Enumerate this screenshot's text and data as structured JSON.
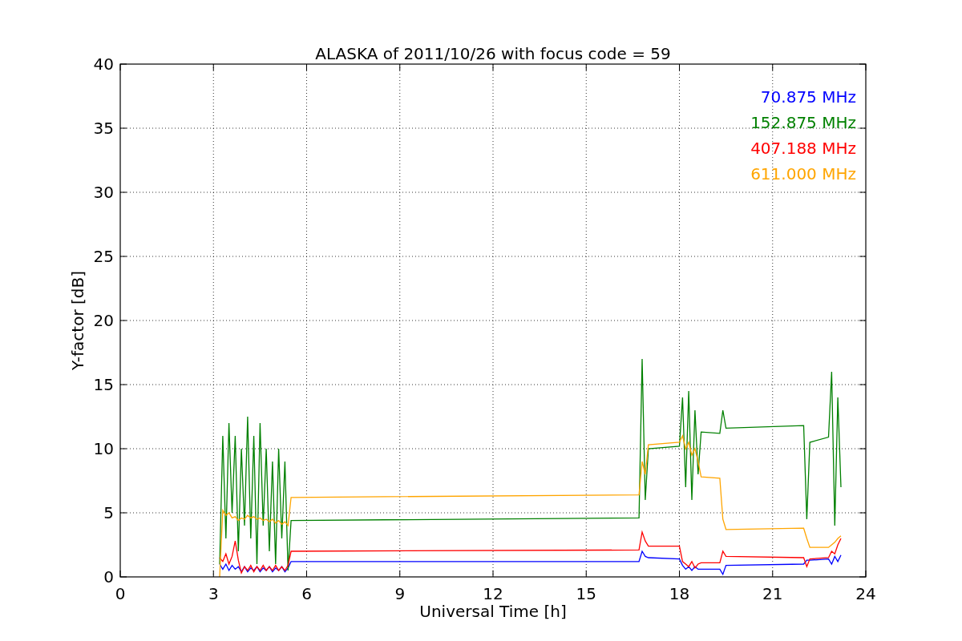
{
  "figure": {
    "chart_data": {
      "type": "line",
      "title": "ALASKA of 2011/10/26 with focus code = 59",
      "xlabel": "Universal Time [h]",
      "ylabel": "Y-factor [dB]",
      "x": [
        3.2,
        3.3,
        3.4,
        3.5,
        3.6,
        3.7,
        3.8,
        3.9,
        4.0,
        4.1,
        4.2,
        4.3,
        4.4,
        4.5,
        4.6,
        4.7,
        4.8,
        4.9,
        5.0,
        5.1,
        5.2,
        5.3,
        5.4,
        5.5,
        16.7,
        16.8,
        16.9,
        17.0,
        18.0,
        18.1,
        18.2,
        18.3,
        18.4,
        18.5,
        18.6,
        18.7,
        19.3,
        19.4,
        19.5,
        22.0,
        22.1,
        22.2,
        22.8,
        22.9,
        23.0,
        23.1,
        23.2
      ],
      "series": [
        {
          "name": "70.875 MHz",
          "color": "#0000ff",
          "values": [
            1.0,
            0.6,
            1.0,
            0.5,
            0.9,
            0.6,
            0.8,
            0.4,
            0.8,
            0.4,
            0.7,
            0.5,
            0.8,
            0.4,
            0.7,
            0.5,
            0.8,
            0.4,
            0.7,
            0.5,
            0.8,
            0.4,
            0.7,
            1.2,
            1.2,
            2.0,
            1.6,
            1.5,
            1.4,
            0.9,
            0.6,
            0.8,
            0.5,
            0.8,
            0.6,
            0.6,
            0.6,
            0.2,
            0.9,
            1.0,
            1.3,
            1.3,
            1.4,
            1.0,
            1.6,
            1.2,
            1.7
          ]
        },
        {
          "name": "152.875 MHz",
          "color": "#008000",
          "values": [
            1,
            11,
            3,
            12,
            5,
            11,
            2,
            10,
            4,
            12.5,
            3,
            11,
            1,
            12,
            4,
            10,
            2,
            9,
            1,
            10,
            3,
            9,
            0.5,
            4.4,
            4.6,
            17,
            6,
            10,
            10.2,
            14,
            7,
            14.5,
            6,
            13,
            8,
            11.3,
            11.2,
            13,
            11.6,
            11.8,
            4.5,
            10.5,
            10.9,
            16,
            4,
            14,
            7
          ]
        },
        {
          "name": "407.188 MHz",
          "color": "#ff0000",
          "values": [
            1.5,
            1.2,
            1.8,
            1.0,
            1.6,
            2.8,
            1.3,
            0.3,
            0.8,
            0.5,
            0.9,
            0.4,
            0.8,
            0.5,
            0.9,
            0.5,
            0.8,
            0.5,
            0.9,
            0.5,
            0.8,
            0.5,
            0.9,
            2.0,
            2.1,
            3.5,
            2.8,
            2.4,
            2.4,
            1.2,
            1.0,
            0.8,
            1.2,
            0.7,
            1.0,
            1.1,
            1.1,
            2.0,
            1.6,
            1.5,
            0.8,
            1.4,
            1.5,
            2.0,
            1.8,
            2.5,
            3.0
          ]
        },
        {
          "name": "611.000 MHz",
          "color": "#ffa500",
          "values": [
            0,
            5.2,
            4.8,
            5,
            4.6,
            4.7,
            4.4,
            4.6,
            4.5,
            4.8,
            4.6,
            4.7,
            4.5,
            4.6,
            4.4,
            4.5,
            4.3,
            4.5,
            4.2,
            4.4,
            4.1,
            4.3,
            4.0,
            6.2,
            6.4,
            9,
            8,
            10.3,
            10.5,
            11,
            10,
            10.5,
            9.5,
            10,
            9,
            7.8,
            7.7,
            4.5,
            3.7,
            3.8,
            3.0,
            2.3,
            2.3,
            2.5,
            2.7,
            3.0,
            3.2
          ]
        }
      ],
      "grid": true,
      "xlim": [
        0,
        24
      ],
      "ylim": [
        0,
        40
      ],
      "xticks": [
        0,
        3,
        6,
        9,
        12,
        15,
        18,
        21,
        24
      ],
      "yticks": [
        0,
        5,
        10,
        15,
        20,
        25,
        30,
        35,
        40
      ]
    }
  }
}
